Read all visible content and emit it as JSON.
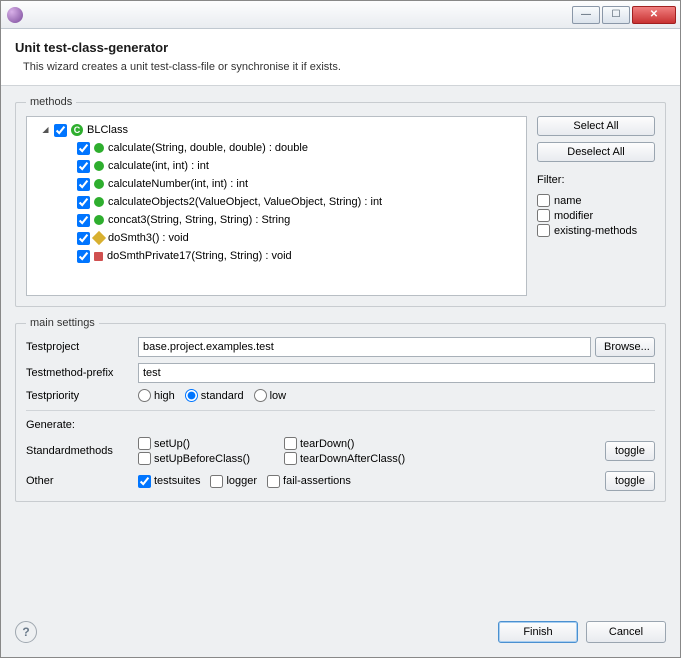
{
  "header": {
    "title": "Unit test-class-generator",
    "subtitle": "This wizard creates a unit test-class-file or synchronise it if exists."
  },
  "methodsGroup": {
    "legend": "methods",
    "rootName": "BLClass",
    "methods": [
      {
        "sig": "calculate(String, double, double) : double",
        "vis": "pub",
        "checked": true
      },
      {
        "sig": "calculate(int, int) : int",
        "vis": "pub",
        "checked": true
      },
      {
        "sig": "calculateNumber(int, int) : int",
        "vis": "pub",
        "checked": true
      },
      {
        "sig": "calculateObjects2(ValueObject, ValueObject, String) : int",
        "vis": "pub",
        "checked": true
      },
      {
        "sig": "concat3(String, String, String) : String",
        "vis": "pub",
        "checked": true
      },
      {
        "sig": "doSmth3() : void",
        "vis": "prot",
        "checked": true
      },
      {
        "sig": "doSmthPrivate17(String, String) : void",
        "vis": "priv",
        "checked": true
      }
    ],
    "selectAll": "Select All",
    "deselectAll": "Deselect All",
    "filterLabel": "Filter:",
    "filters": [
      {
        "key": "name",
        "label": "name",
        "checked": false
      },
      {
        "key": "modifier",
        "label": "modifier",
        "checked": false
      },
      {
        "key": "existing",
        "label": "existing-methods",
        "checked": false
      }
    ]
  },
  "settingsGroup": {
    "legend": "main settings",
    "testprojectLabel": "Testproject",
    "testprojectValue": "base.project.examples.test",
    "browse": "Browse...",
    "prefixLabel": "Testmethod-prefix",
    "prefixValue": "test",
    "priorityLabel": "Testpriority",
    "priorities": [
      {
        "key": "high",
        "label": "high",
        "checked": false
      },
      {
        "key": "standard",
        "label": "standard",
        "checked": true
      },
      {
        "key": "low",
        "label": "low",
        "checked": false
      }
    ],
    "generateLabel": "Generate:",
    "stdLabel": "Standardmethods",
    "std": [
      {
        "key": "setUp",
        "label": "setUp()",
        "checked": false
      },
      {
        "key": "setUpBeforeClass",
        "label": "setUpBeforeClass()",
        "checked": false
      },
      {
        "key": "tearDown",
        "label": "tearDown()",
        "checked": false
      },
      {
        "key": "tearDownAfterClass",
        "label": "tearDownAfterClass()",
        "checked": false
      }
    ],
    "otherLabel": "Other",
    "other": [
      {
        "key": "testsuites",
        "label": "testsuites",
        "checked": true
      },
      {
        "key": "logger",
        "label": "logger",
        "checked": false
      },
      {
        "key": "fail",
        "label": "fail-assertions",
        "checked": false
      }
    ],
    "toggle": "toggle"
  },
  "footer": {
    "finish": "Finish",
    "cancel": "Cancel"
  }
}
